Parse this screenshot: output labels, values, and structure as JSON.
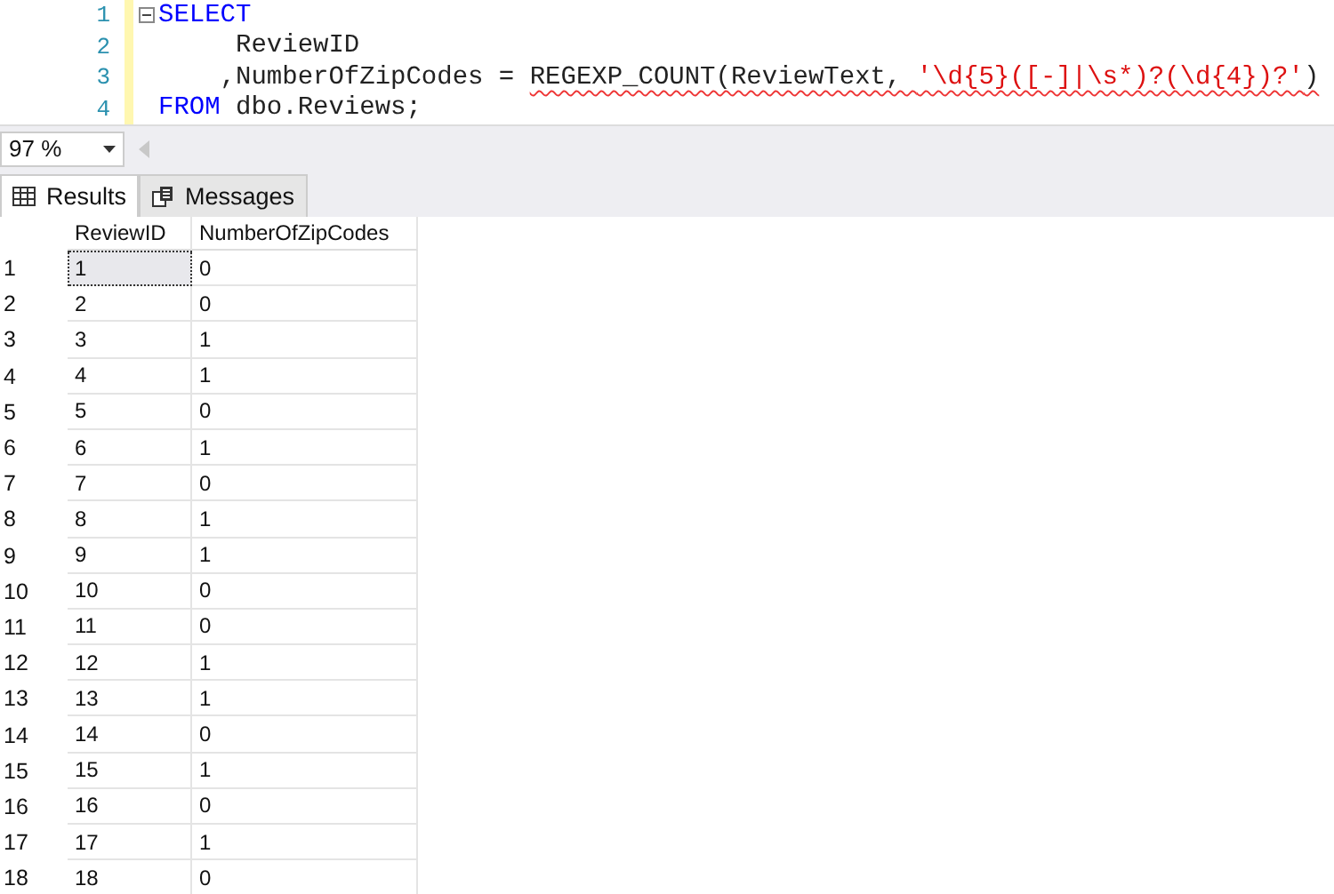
{
  "editor": {
    "lines": [
      {
        "number": "1",
        "collapsible": true,
        "tokens": [
          {
            "kind": "keyword",
            "text": "SELECT",
            "squiggle": false
          }
        ]
      },
      {
        "number": "2",
        "collapsible": false,
        "tokens": [
          {
            "kind": "plain",
            "text": "     ReviewID",
            "squiggle": false
          }
        ]
      },
      {
        "number": "3",
        "collapsible": false,
        "tokens": [
          {
            "kind": "plain",
            "text": "    ,NumberOfZipCodes = ",
            "squiggle": false
          },
          {
            "kind": "plain",
            "text": "REGEXP_COUNT(ReviewText, ",
            "squiggle": true
          },
          {
            "kind": "string",
            "text": "'\\d{5}([-]|\\s*)?(\\d{4})?'",
            "squiggle": true
          },
          {
            "kind": "plain",
            "text": ")",
            "squiggle": true
          }
        ]
      },
      {
        "number": "4",
        "collapsible": false,
        "tokens": [
          {
            "kind": "keyword",
            "text": "FROM",
            "squiggle": false
          },
          {
            "kind": "plain",
            "text": " dbo.Reviews;",
            "squiggle": false
          }
        ]
      }
    ]
  },
  "zoom": {
    "value": "97 %"
  },
  "tabs": [
    {
      "label": "Results",
      "selected": true
    },
    {
      "label": "Messages",
      "selected": false
    }
  ],
  "results": {
    "columns": [
      "ReviewID",
      "NumberOfZipCodes"
    ],
    "rows": [
      {
        "number": "1",
        "cells": [
          "1",
          "0"
        ],
        "selected": true
      },
      {
        "number": "2",
        "cells": [
          "2",
          "0"
        ],
        "selected": false
      },
      {
        "number": "3",
        "cells": [
          "3",
          "1"
        ],
        "selected": false
      },
      {
        "number": "4",
        "cells": [
          "4",
          "1"
        ],
        "selected": false
      },
      {
        "number": "5",
        "cells": [
          "5",
          "0"
        ],
        "selected": false
      },
      {
        "number": "6",
        "cells": [
          "6",
          "1"
        ],
        "selected": false
      },
      {
        "number": "7",
        "cells": [
          "7",
          "0"
        ],
        "selected": false
      },
      {
        "number": "8",
        "cells": [
          "8",
          "1"
        ],
        "selected": false
      },
      {
        "number": "9",
        "cells": [
          "9",
          "1"
        ],
        "selected": false
      },
      {
        "number": "10",
        "cells": [
          "10",
          "0"
        ],
        "selected": false
      },
      {
        "number": "11",
        "cells": [
          "11",
          "0"
        ],
        "selected": false
      },
      {
        "number": "12",
        "cells": [
          "12",
          "1"
        ],
        "selected": false
      },
      {
        "number": "13",
        "cells": [
          "13",
          "1"
        ],
        "selected": false
      },
      {
        "number": "14",
        "cells": [
          "14",
          "0"
        ],
        "selected": false
      },
      {
        "number": "15",
        "cells": [
          "15",
          "1"
        ],
        "selected": false
      },
      {
        "number": "16",
        "cells": [
          "16",
          "0"
        ],
        "selected": false
      },
      {
        "number": "17",
        "cells": [
          "17",
          "1"
        ],
        "selected": false
      },
      {
        "number": "18",
        "cells": [
          "18",
          "0"
        ],
        "selected": false
      }
    ]
  }
}
